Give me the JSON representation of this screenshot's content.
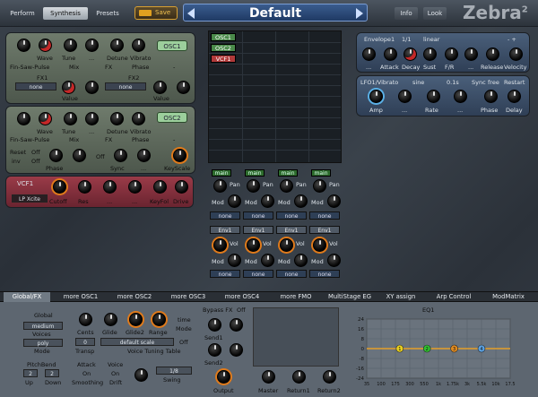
{
  "header": {
    "tabs": [
      "Perform",
      "Synthesis",
      "Presets"
    ],
    "active_tab": "Synthesis",
    "save_label": "Save",
    "preset_name": "Default",
    "info_label": "Info",
    "look_label": "Look",
    "logo_text": "Zebra",
    "logo_sup": "2"
  },
  "osc1": {
    "knob_labels": [
      "Wave",
      "Tune",
      "...",
      "Detune",
      "Vibrato"
    ],
    "title": "OSC1",
    "wave_mode": "Fin-Saw-Pulse",
    "mix_label": "Mix",
    "fx_label": "FX",
    "phase_label": "Phase",
    "dash": "-",
    "fx1_label": "FX1",
    "fx2_label": "FX2",
    "none1": "none",
    "none2": "none",
    "value1": "Value",
    "value2": "Value"
  },
  "osc2": {
    "knob_labels": [
      "Wave",
      "Tune",
      "...",
      "Detune",
      "Vibrato"
    ],
    "title": "OSC2",
    "wave_mode": "Fin-Saw-Pulse",
    "mix_label": "Mix",
    "fx_label": "FX",
    "phase_label": "Phase",
    "dash": "-",
    "reset_label": "Reset",
    "reset_value": "Off",
    "inv_label": "inv",
    "inv_value": "Off",
    "off_label": "Off",
    "phase2_label": "Phase",
    "sync_label": "Sync",
    "dots": "...",
    "keyscale_label": "KeyScale"
  },
  "vcf1": {
    "title": "VCF1",
    "filter_type": "LP Xcite",
    "knob_labels": [
      "Cutoff",
      "Res",
      "...",
      "...",
      "KeyFol",
      "Drive"
    ]
  },
  "grid": {
    "slots": [
      "OSC1",
      "OSC2",
      "VCF1"
    ],
    "main_labels": [
      "main",
      "main",
      "main",
      "main"
    ],
    "pan_label": "Pan",
    "mod_label": "Mod",
    "vol_label": "Vol",
    "none_label": "none",
    "env_labels": [
      "Env1",
      "Env1",
      "Env1",
      "Env1"
    ]
  },
  "envelope1": {
    "title": "Envelope1",
    "ratio": "1/1",
    "mode": "linear",
    "plusminus": "- +",
    "knob_labels": [
      "...",
      "Attack",
      "Decay",
      "Sust",
      "F/R",
      "...",
      "Release",
      "Velocity"
    ]
  },
  "lfo1": {
    "title": "LFO1/Vibrato",
    "waveform": "sine",
    "rate_value": "0.1s",
    "sync_label": "Sync",
    "free_label": "free",
    "restart_label": "Restart",
    "amp_label": "Amp",
    "rate_label": "Rate",
    "dots": "...",
    "phase_label": "Phase",
    "delay_label": "Delay"
  },
  "bottom_tabs": [
    "Global/FX",
    "more OSC1",
    "more OSC2",
    "more OSC3",
    "more OSC4",
    "more FMO",
    "MultiStage EG",
    "XY assign",
    "Arp Control",
    "ModMatrix"
  ],
  "active_bottom_tab": "Global/FX",
  "global": {
    "title": "Global",
    "voices_value": "medium",
    "voices_label": "Voices",
    "mode_value": "poly",
    "mode_label": "Mode",
    "cents_label": "Cents",
    "glide_label": "Glide",
    "glide2_label": "Glide2",
    "range_label": "Range",
    "time_label": "time",
    "mode2_label": "Mode",
    "transp_value": "0",
    "transp_label": "Transp",
    "scale_value": "default scale",
    "scale_off": "Off",
    "tuning_label": "Voice Tuning Table",
    "pitchbend_label": "PitchBend",
    "pb_up": "2",
    "pb_down": "2",
    "up_label": "Up",
    "down_label": "Down",
    "attack_label": "Attack",
    "attack_value": "On",
    "smoothing_label": "Smoothing",
    "voice_label": "Voice",
    "voice_value": "On",
    "drift_label": "Drift",
    "swing_value": "1/8",
    "swing_label": "Swing"
  },
  "fx": {
    "bypass_label": "Bypass FX",
    "bypass_value": "Off",
    "send1_label": "Send1",
    "send2_label": "Send2",
    "output_label": "Output",
    "master_label": "Master",
    "return1_label": "Return1",
    "return2_label": "Return2"
  },
  "eq": {
    "title": "EQ1",
    "y_ticks": [
      "24",
      "16",
      "8",
      "0",
      "-8",
      "-16",
      "-24"
    ],
    "x_ticks": [
      "35",
      "100",
      "175",
      "300",
      "550",
      "1k",
      "1.75k",
      "3k",
      "5.5k",
      "10k",
      "17.5"
    ],
    "bands": [
      {
        "name": "1",
        "color": "#e8d020"
      },
      {
        "name": "2",
        "color": "#30c030"
      },
      {
        "name": "3",
        "color": "#e08a20"
      },
      {
        "name": "4",
        "color": "#5aa0e0"
      }
    ]
  }
}
